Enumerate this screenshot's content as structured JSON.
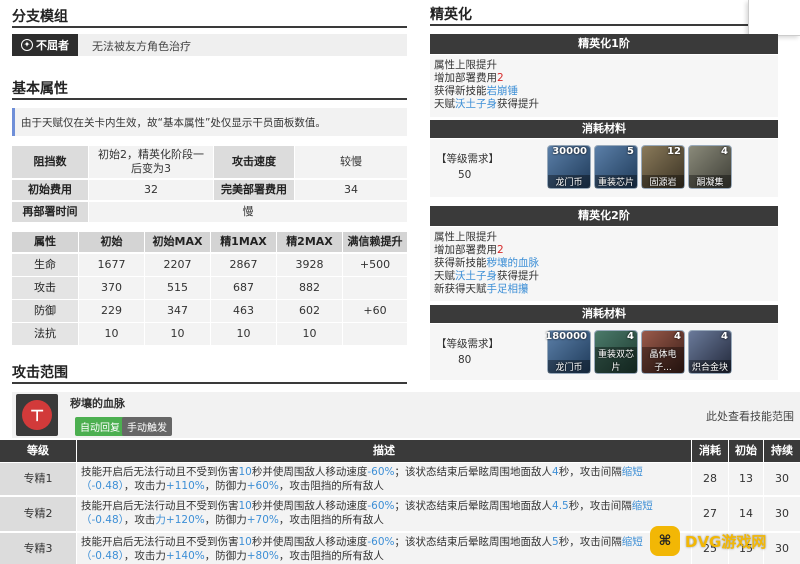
{
  "branch": {
    "title": "分支模组",
    "badge": "不屈者",
    "desc": "无法被友方角色治疗"
  },
  "basic": {
    "title": "基本属性",
    "note": "由于天赋仅在关卡内生效，故“基本属性”处仅显示干员面板数值。",
    "block_label": "阻挡数",
    "block_value": "初始2，精英化阶段一后变为3",
    "atkspd_label": "攻击速度",
    "atkspd_value": "较慢",
    "cost_label": "初始费用",
    "cost_value": "32",
    "fullcost_label": "完美部署费用",
    "fullcost_value": "34",
    "redeploy_label": "再部署时间",
    "redeploy_value": "慢"
  },
  "stats": {
    "headers": [
      "属性",
      "初始",
      "初始MAX",
      "精1MAX",
      "精2MAX",
      "满信赖提升"
    ],
    "rows": [
      [
        "生命",
        "1677",
        "2207",
        "2867",
        "3928",
        "+500"
      ],
      [
        "攻击",
        "370",
        "515",
        "687",
        "882",
        ""
      ],
      [
        "防御",
        "229",
        "347",
        "463",
        "602",
        "+60"
      ],
      [
        "法抗",
        "10",
        "10",
        "10",
        "10",
        ""
      ]
    ]
  },
  "elite": {
    "title": "精英化",
    "e1": {
      "header": "精英化1阶",
      "line1": "属性上限提升",
      "line2a": "增加部署费用",
      "line2b": "2",
      "line3a": "获得新技能",
      "line3b": "岩崩锤",
      "line4a": "天赋",
      "line4b": "沃土子身",
      "line4c": "获得提升",
      "mat_header": "消耗材料",
      "level_label": "【等级需求】",
      "level_value": "50",
      "items": [
        {
          "count": "30000",
          "name": "龙门币"
        },
        {
          "count": "5",
          "name": "重装芯片"
        },
        {
          "count": "12",
          "name": "固源岩"
        },
        {
          "count": "4",
          "name": "酮凝集"
        }
      ]
    },
    "e2": {
      "header": "精英化2阶",
      "line1": "属性上限提升",
      "line2a": "增加部署费用",
      "line2b": "2",
      "line3a": "获得新技能",
      "line3b": "秽壤的血脉",
      "line4a": "天赋",
      "line4b": "沃土子身",
      "line4c": "获得提升",
      "line5a": "新获得天赋",
      "line5b": "手足相攥",
      "mat_header": "消耗材料",
      "level_label": "【等级需求】",
      "level_value": "80",
      "items": [
        {
          "count": "180000",
          "name": "龙门币"
        },
        {
          "count": "4",
          "name": "重装双芯片"
        },
        {
          "count": "4",
          "name": "晶体电子..."
        },
        {
          "count": "4",
          "name": "炽合金块"
        }
      ]
    }
  },
  "range": {
    "title": "攻击范围"
  },
  "skill": {
    "name": "秽壤的血脉",
    "tag_auto": "自动回复",
    "tag_manual": "手动触发",
    "range_link": "此处查看技能范围",
    "headers": [
      "等级",
      "描述",
      "消耗",
      "初始",
      "持续"
    ],
    "rows": [
      {
        "level": "专精1",
        "d1": "技能开启后无法行动且不受到伤害",
        "d2": "10",
        "d3": "秒并使周围敌人移动速度",
        "d4": "-60%",
        "d5": "；该状态结束后晕眩周围地面敌人",
        "d6": "4",
        "d7": "秒，攻击间隔",
        "d8": "缩短",
        "d9": "（-0.48）",
        "d10": "，攻击力",
        "d11": "+110%",
        "d12": "，防御力",
        "d13": "+60%",
        "d14": "，攻击阻挡的所有敌人",
        "cost": "28",
        "init": "13",
        "dur": "30"
      },
      {
        "level": "专精2",
        "d1": "技能开启后无法行动且不受到伤害",
        "d2": "10",
        "d3": "秒并使周围敌人移动速度",
        "d4": "-60%",
        "d5": "；该状态结束后晕眩周围地面敌人",
        "d6": "4.5",
        "d7": "秒，攻击间隔",
        "d8": "缩短",
        "d9": "（-0.48）",
        "d10": "，攻击",
        "d11": "力+120%",
        "d12": "，防御力",
        "d13": "+70%",
        "d14": "，攻击阻挡的所有敌人",
        "cost": "27",
        "init": "14",
        "dur": "30"
      },
      {
        "level": "专精3",
        "d1": "技能开启后无法行动且不受到伤害",
        "d2": "10",
        "d3": "秒并使周围敌人移动速度",
        "d4": "-60%",
        "d5": "；该状态结束后晕眩周围地面敌人",
        "d6": "5",
        "d7": "秒，攻击间隔",
        "d8": "缩短",
        "d9": "（-0.48）",
        "d10": "，攻击力",
        "d11": "+140%",
        "d12": "，防御力",
        "d13": "+80%",
        "d14": "，攻击阻挡的所有敌人",
        "cost": "25",
        "init": "15",
        "dur": "30"
      }
    ]
  },
  "watermark": "DVG游戏网",
  "colors": {
    "accent": "#3d8fd6",
    "dark": "#3a3a3a",
    "red": "#d62a2a"
  }
}
